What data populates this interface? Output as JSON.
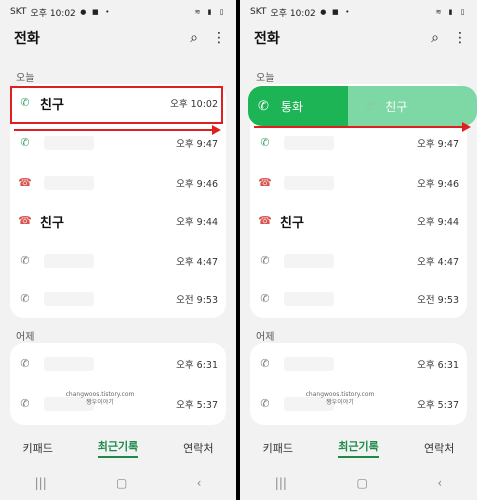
{
  "status_bar": {
    "carrier": "SKT",
    "time": "오후 10:02"
  },
  "app": {
    "title": "전화"
  },
  "sections": {
    "today": "오늘",
    "yesterday": "어제"
  },
  "left": {
    "today_rows": [
      {
        "name": "친구",
        "time": "오후 10:02",
        "type": "incoming"
      },
      {
        "name": "",
        "time": "오후 9:47",
        "type": "incoming"
      },
      {
        "name": "",
        "time": "오후 9:46",
        "type": "missed"
      },
      {
        "name": "친구",
        "time": "오후 9:44",
        "type": "missed"
      },
      {
        "name": "",
        "time": "오후 4:47",
        "type": "outgoing"
      },
      {
        "name": "",
        "time": "오전 9:53",
        "type": "outgoing"
      }
    ],
    "yesterday_rows": [
      {
        "name": "",
        "time": "오후 6:31",
        "type": "outgoing"
      },
      {
        "name": "",
        "time": "오후 5:37",
        "type": "outgoing"
      }
    ]
  },
  "right": {
    "swipe": {
      "call_label": "통화",
      "friend_label": "친구"
    },
    "today_rows": [
      {
        "name": "",
        "time": "오후 9:47",
        "type": "incoming"
      },
      {
        "name": "",
        "time": "오후 9:46",
        "type": "missed"
      },
      {
        "name": "친구",
        "time": "오후 9:44",
        "type": "missed"
      },
      {
        "name": "",
        "time": "오후 4:47",
        "type": "outgoing"
      },
      {
        "name": "",
        "time": "오전 9:53",
        "type": "outgoing"
      }
    ],
    "yesterday_rows": [
      {
        "name": "",
        "time": "오후 6:31",
        "type": "outgoing"
      },
      {
        "name": "",
        "time": "오후 5:37",
        "type": "outgoing"
      }
    ]
  },
  "watermark": {
    "line1": "changwoos.tistory.com",
    "line2": "짱우이야기"
  },
  "bottom_nav": {
    "keypad": "키패드",
    "recents": "최근기록",
    "contacts": "연락처"
  },
  "colors": {
    "accent": "#1e8a4a",
    "swipe_call": "#1db456",
    "swipe_friend": "#7ed8a6",
    "highlight": "#e02020"
  },
  "icons": {
    "search": "search-icon",
    "more": "more-vert-icon"
  }
}
